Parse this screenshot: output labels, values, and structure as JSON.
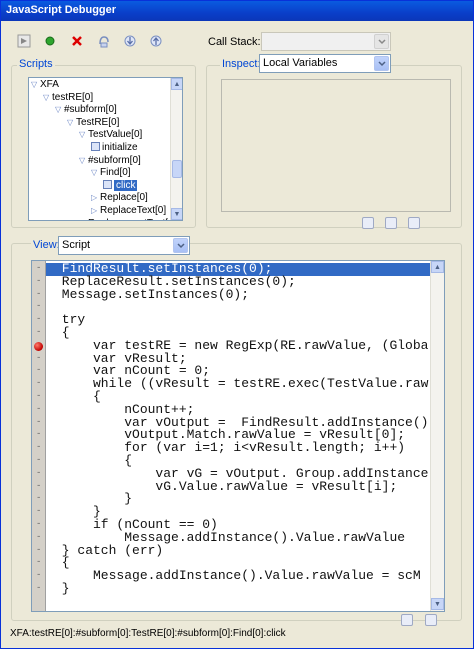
{
  "window": {
    "title": "JavaScript Debugger"
  },
  "toolbar": {
    "buttons": [
      {
        "name": "continue-button",
        "icon": "arrow-right-icon"
      },
      {
        "name": "step-button",
        "icon": "green-dot-icon"
      },
      {
        "name": "stop-button",
        "icon": "red-x-icon"
      },
      {
        "name": "step-over-button",
        "icon": "step-over-icon"
      },
      {
        "name": "step-into-button",
        "icon": "step-into-icon"
      },
      {
        "name": "step-out-button",
        "icon": "step-out-icon"
      }
    ],
    "callstack_label": "Call Stack:",
    "callstack_value": ""
  },
  "scripts": {
    "title": "Scripts",
    "tree": [
      {
        "label": "XFA",
        "expanded": true
      },
      {
        "label": "testRE[0]",
        "expanded": true
      },
      {
        "label": "#subform[0]",
        "expanded": true
      },
      {
        "label": "TestRE[0]",
        "expanded": true
      },
      {
        "label": "TestValue[0]",
        "expanded": true
      },
      {
        "label": "initialize",
        "leaf": true
      },
      {
        "label": "#subform[0]",
        "expanded": true
      },
      {
        "label": "Find[0]",
        "expanded": true
      },
      {
        "label": "click",
        "leaf": true,
        "selected": true
      },
      {
        "label": "Replace[0]",
        "expanded": false
      },
      {
        "label": "ReplaceText[0]",
        "expanded": false
      },
      {
        "label": "ReplacementText[",
        "expanded": false
      }
    ]
  },
  "inspect": {
    "label": "Inspect:",
    "value": "Local Variables"
  },
  "view": {
    "label": "View:",
    "value": "Script"
  },
  "code": {
    "lines": [
      " FindResult.setInstances(0);",
      " ReplaceResult.setInstances(0);",
      " Message.setInstances(0);",
      "",
      " try",
      " {",
      "     var testRE = new RegExp(RE.rawValue, (Globa",
      "     var vResult;",
      "     var nCount = 0;",
      "     while ((vResult = testRE.exec(TestValue.raw",
      "     {",
      "         nCount++;",
      "         var vOutput =  FindResult.addInstance()",
      "         vOutput.Match.rawValue = vResult[0];",
      "         for (var i=1; i<vResult.length; i++)",
      "         {",
      "             var vG = vOutput. Group.addInstance",
      "             vG.Value.rawValue = vResult[i];",
      "         }",
      "     }",
      "     if (nCount == 0)",
      "         Message.addInstance().Value.rawValue",
      " } catch (err)",
      " {",
      "     Message.addInstance().Value.rawValue = scM",
      " }"
    ],
    "highlighted_line": 0,
    "breakpoint_line": 6
  },
  "status": {
    "path": "XFA:testRE[0]:#subform[0]:TestRE[0]:#subform[0]:Find[0]:click"
  },
  "colors": {
    "title_bar": "#0a4fd6",
    "selection": "#316ac5",
    "group_title": "#0046d5",
    "breakpoint": "#c00000"
  }
}
